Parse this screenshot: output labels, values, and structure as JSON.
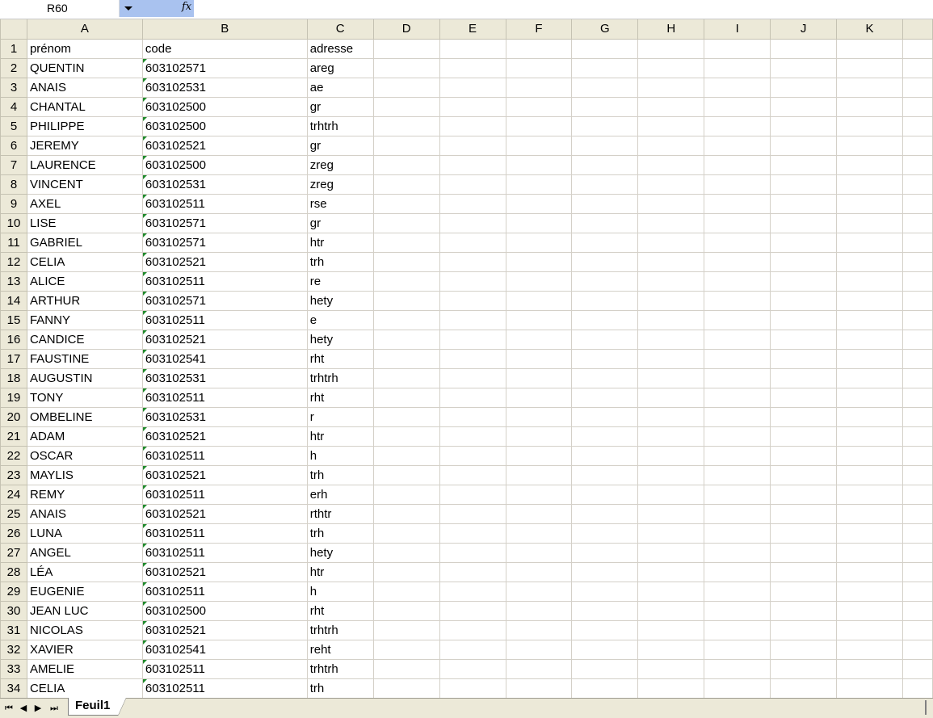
{
  "formula_bar": {
    "name_box": "R60",
    "fx_label": "fx"
  },
  "columns": [
    "A",
    "B",
    "C",
    "D",
    "E",
    "F",
    "G",
    "H",
    "I",
    "J",
    "K"
  ],
  "rows": [
    {
      "num": "1",
      "a": "prénom",
      "b": "code",
      "c": "adresse",
      "number_as_text": false
    },
    {
      "num": "2",
      "a": "QUENTIN",
      "b": "603102571",
      "c": "areg",
      "number_as_text": true
    },
    {
      "num": "3",
      "a": "ANAIS",
      "b": "603102531",
      "c": "ae",
      "number_as_text": true
    },
    {
      "num": "4",
      "a": "CHANTAL",
      "b": "603102500",
      "c": "gr",
      "number_as_text": true
    },
    {
      "num": "5",
      "a": "PHILIPPE",
      "b": "603102500",
      "c": "trhtrh",
      "number_as_text": true
    },
    {
      "num": "6",
      "a": "JEREMY",
      "b": "603102521",
      "c": "gr",
      "number_as_text": true
    },
    {
      "num": "7",
      "a": "LAURENCE",
      "b": "603102500",
      "c": "zreg",
      "number_as_text": true
    },
    {
      "num": "8",
      "a": "VINCENT",
      "b": "603102531",
      "c": "zreg",
      "number_as_text": true
    },
    {
      "num": "9",
      "a": "AXEL",
      "b": "603102511",
      "c": "rse",
      "number_as_text": true
    },
    {
      "num": "10",
      "a": "LISE",
      "b": "603102571",
      "c": "gr",
      "number_as_text": true
    },
    {
      "num": "11",
      "a": "GABRIEL",
      "b": "603102571",
      "c": "htr",
      "number_as_text": true
    },
    {
      "num": "12",
      "a": "CELIA",
      "b": "603102521",
      "c": "trh",
      "number_as_text": true
    },
    {
      "num": "13",
      "a": "ALICE",
      "b": "603102511",
      "c": "re",
      "number_as_text": true
    },
    {
      "num": "14",
      "a": "ARTHUR",
      "b": "603102571",
      "c": "hety",
      "number_as_text": true
    },
    {
      "num": "15",
      "a": "FANNY",
      "b": "603102511",
      "c": "e",
      "number_as_text": true
    },
    {
      "num": "16",
      "a": "CANDICE",
      "b": "603102521",
      "c": "hety",
      "number_as_text": true
    },
    {
      "num": "17",
      "a": "FAUSTINE",
      "b": "603102541",
      "c": "rht",
      "number_as_text": true
    },
    {
      "num": "18",
      "a": "AUGUSTIN",
      "b": "603102531",
      "c": "trhtrh",
      "number_as_text": true
    },
    {
      "num": "19",
      "a": "TONY",
      "b": "603102511",
      "c": "rht",
      "number_as_text": true
    },
    {
      "num": "20",
      "a": "OMBELINE",
      "b": "603102531",
      "c": "r",
      "number_as_text": true
    },
    {
      "num": "21",
      "a": "ADAM",
      "b": "603102521",
      "c": "htr",
      "number_as_text": true
    },
    {
      "num": "22",
      "a": "OSCAR",
      "b": "603102511",
      "c": "h",
      "number_as_text": true
    },
    {
      "num": "23",
      "a": "MAYLIS",
      "b": "603102521",
      "c": "trh",
      "number_as_text": true
    },
    {
      "num": "24",
      "a": "REMY",
      "b": "603102511",
      "c": "erh",
      "number_as_text": true
    },
    {
      "num": "25",
      "a": "ANAIS",
      "b": "603102521",
      "c": "rthtr",
      "number_as_text": true
    },
    {
      "num": "26",
      "a": "LUNA",
      "b": "603102511",
      "c": "trh",
      "number_as_text": true
    },
    {
      "num": "27",
      "a": "ANGEL",
      "b": "603102511",
      "c": "hety",
      "number_as_text": true
    },
    {
      "num": "28",
      "a": "LÉA",
      "b": "603102521",
      "c": "htr",
      "number_as_text": true
    },
    {
      "num": "29",
      "a": "EUGENIE",
      "b": "603102511",
      "c": "h",
      "number_as_text": true
    },
    {
      "num": "30",
      "a": "JEAN LUC",
      "b": "603102500",
      "c": "rht",
      "number_as_text": true
    },
    {
      "num": "31",
      "a": "NICOLAS",
      "b": "603102521",
      "c": "trhtrh",
      "number_as_text": true
    },
    {
      "num": "32",
      "a": "XAVIER",
      "b": "603102541",
      "c": "reht",
      "number_as_text": true
    },
    {
      "num": "33",
      "a": "AMELIE",
      "b": "603102511",
      "c": "trhtrh",
      "number_as_text": true
    },
    {
      "num": "34",
      "a": "CELIA",
      "b": "603102511",
      "c": "trh",
      "number_as_text": true
    }
  ],
  "sheet_tabs": [
    {
      "label": "Feuil1",
      "active": true
    }
  ],
  "tab_nav_icons": [
    "first-sheet-icon",
    "prev-sheet-icon",
    "next-sheet-icon",
    "last-sheet-icon"
  ],
  "colors": {
    "header_bg": "#ece9d8",
    "toolbar_accent": "#a9c2ef",
    "error_marker": "#1f8a2b"
  }
}
